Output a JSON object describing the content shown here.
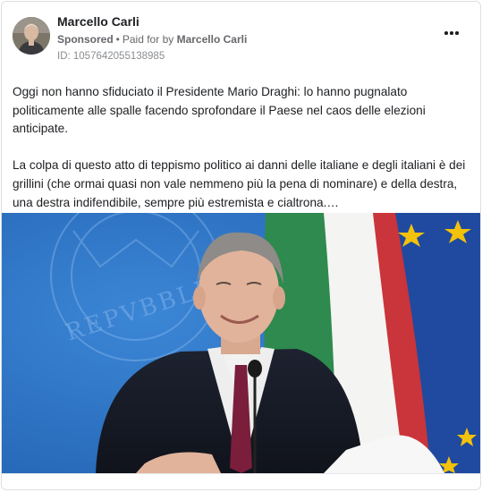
{
  "post": {
    "author_name": "Marcello Carli",
    "sponsored_label": "Sponsored",
    "separator": "•",
    "paid_for_prefix": "Paid for by",
    "payer_name": "Marcello Carli",
    "ad_id": "ID: 1057642055138985",
    "more_icon": "more-horizontal-icon",
    "paragraphs": [
      "Oggi non hanno sfiduciato il Presidente Mario Draghi: lo hanno pugnalato politicamente alle spalle facendo sprofondare il Paese nel caos delle elezioni anticipate.",
      "La colpa di questo atto di teppismo politico ai danni delle italiane e degli italiani è dei grillini (che ormai quasi non vale nemmeno più la pena di nominare) e della destra, una destra indifendibile, sempre più estremista e cialtrona.…"
    ],
    "image_text": "REPVBBLICA"
  },
  "colors": {
    "text_primary": "#1c1e21",
    "text_secondary": "#65676b",
    "backdrop_blue": "#2b74c8",
    "flag_green": "#2e8a4e",
    "flag_red": "#c9353a",
    "eu_blue": "#1f4aa0",
    "eu_star": "#f3c20a",
    "tie": "#7a1e3c"
  }
}
